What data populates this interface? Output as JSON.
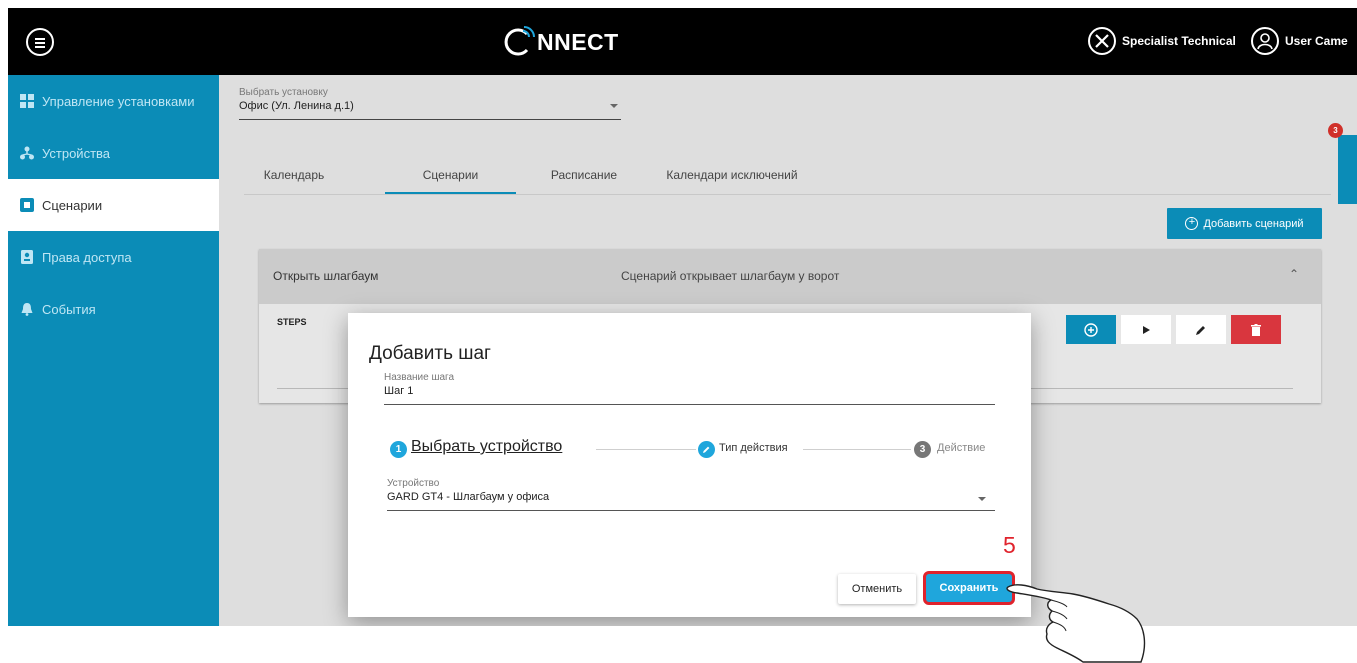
{
  "header": {
    "logo_text": "NNECT",
    "specialist_label": "Specialist Technical",
    "user_label": "User Came"
  },
  "sidebar": {
    "items": [
      {
        "label": "Управление установками",
        "icon": "grid-icon",
        "active": false
      },
      {
        "label": "Устройства",
        "icon": "network-icon",
        "active": false
      },
      {
        "label": "Сценарии",
        "icon": "scenario-icon",
        "active": true
      },
      {
        "label": "Права доступа",
        "icon": "badge-icon",
        "active": false
      },
      {
        "label": "События",
        "icon": "bell-icon",
        "active": false
      }
    ]
  },
  "installation": {
    "label": "Выбрать установку",
    "value": "Офис (Ул. Ленина д.1)"
  },
  "tabs": [
    {
      "label": "Календарь",
      "active": false
    },
    {
      "label": "Сценарии",
      "active": true
    },
    {
      "label": "Расписание",
      "active": false
    },
    {
      "label": "Календари исключений",
      "active": false
    }
  ],
  "add_scenario_label": "Добавить сценарий",
  "scenario": {
    "title": "Открыть шлагбаум",
    "description": "Сценарий открывает шлагбаум у ворот",
    "steps_label": "STEPS"
  },
  "notification_count": "3",
  "dialog": {
    "title": "Добавить шаг",
    "name_label": "Название шага",
    "name_value": "Шаг 1",
    "steps": [
      {
        "number": "1",
        "label": "Выбрать устройство"
      },
      {
        "label": "Тип действия"
      },
      {
        "number": "3",
        "label": "Действие"
      }
    ],
    "device_label": "Устройство",
    "device_value": "GARD GT4 - Шлагбаум у офиса",
    "cancel_label": "Отменить",
    "save_label": "Сохранить"
  },
  "annotation_number": "5",
  "colors": {
    "primary": "#0b8cb7",
    "save": "#1fa6dc",
    "danger": "#d9363e",
    "highlight": "#e0232c"
  }
}
